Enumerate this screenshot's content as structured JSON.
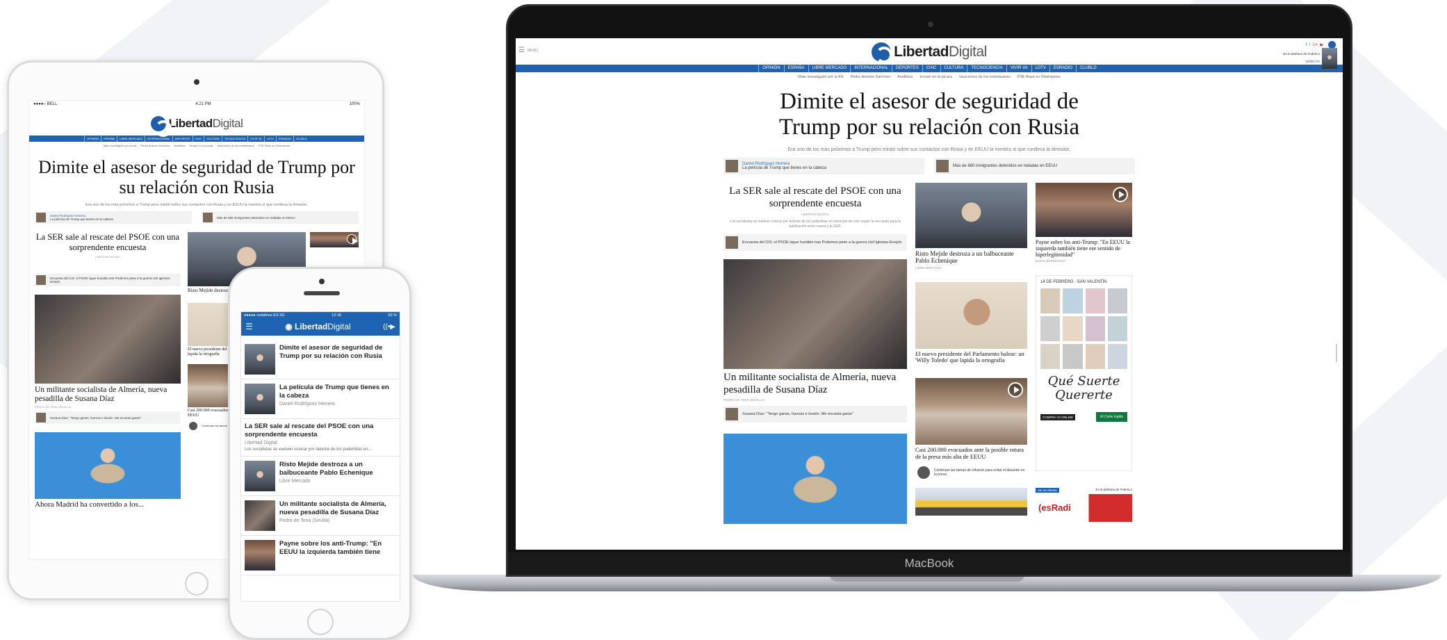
{
  "brand": {
    "name_a": "Libertad",
    "name_b": "Digital",
    "accent": "#1e63b1"
  },
  "macbook": {
    "label": "MacBook",
    "menu_label": "MENÚ",
    "live_label": "DIRECTO",
    "promo_text": "Es la Mañana de Federico",
    "nav": [
      "OPINIÓN",
      "ESPAÑA",
      "LIBRE MERCADO",
      "INTERNACIONAL",
      "DEPORTES",
      "CHIC",
      "CULTURA",
      "TECNOCIENCIA",
      "VIVIR VA",
      "LDTV",
      "ESRADIO",
      "CLUBLD"
    ],
    "subnav": [
      "Malo investigado por la AN",
      "Pedro Antonio Sánchez",
      "Anellidos",
      "Ermán en la pícara",
      "Vasiciones de los entrelauerra",
      "PSE Raxe es Ghampions"
    ],
    "headline": "Dimite el asesor de seguridad de Trump por su relación con Rusia",
    "dek": "Era uno de los más próximos a Trump pero mintió sobre sus contactos con Rusia y en EEUU la mentira sí que conlleva la dimisión.",
    "related": [
      {
        "author": "Daniel Rodríguez Herrera",
        "title": "La película de Trump que tienes en la cabeza"
      },
      {
        "author": "",
        "title": "Más de 680 inmigrantes detenidos en redadas en EEUU"
      }
    ],
    "col1": {
      "lead_title": "La SER sale al rescate del PSOE con una sorprendente encuesta",
      "lead_by": "LIBERTAD DIGITAL",
      "lead_dek": "Los socialistas se vuelven colocar por delante de los podemitas en intención de voto según la encuesta para la publicación entre marzo y la SER.",
      "lead_related": "Encuesta del CIS: el PSOE sigue hundido tras Podemos pese a la guerra civil Iglesias-Errejón",
      "photo_title": "Un militante socialista de Almería, nueva pesadilla de Susana Díaz",
      "photo_by": "PEDRO DE TENA (SEVILLA)",
      "photo_related": "Susana Díaz: \"Tengo ganas, fuerzas e ilusión. Me encanta ganar\""
    },
    "col2": [
      {
        "title": "Risto Mejide destroza a un balbuceante Pablo Echenique",
        "by": "LIBRE MERCADO"
      },
      {
        "title": "El nuevo presidente del Parlamento balear: un 'Willy Toledo' que lapida la ortografía",
        "by": ""
      },
      {
        "title": "Casi 200.000 evacuados ante la posible rotura de la presa más alta de EEUU",
        "by": "",
        "related": "Continúan las tareas de refuerzo para evitar el desastre en la presa"
      }
    ],
    "col3": {
      "story_title": "Payne sobre los anti-Trump: \"En EEUU la izquierda también tiene ese sentido de hiperlegitimidad\"",
      "story_by": "ELENA BERBERANA",
      "ad_date": "14 DE FEBRERO · SAN VALENTÍN",
      "ad_slogan": "Qué Suerte Quererte",
      "ad_cta": "COMPRA YA ONLINE",
      "ad_brand": "El Corte Inglés",
      "radio_tag": "Ver en directo",
      "radio_show": "Es la Mañana de Federico",
      "radio_logo": "(esRadi"
    }
  },
  "ipad": {
    "status_carrier": "●●●●○ BELL",
    "status_time": "4:21 PM",
    "status_battery": "100%",
    "nav": [
      "OPINIÓN",
      "ESPAÑA",
      "LIBRE MERCADO",
      "INTERNACIONAL",
      "DEPORTES",
      "CHIC",
      "CULTURA",
      "TECNOCIENCIA",
      "VIVIR VA",
      "LDTV",
      "ESRADIO",
      "CLUBLD"
    ],
    "subnav": [
      "Malo investigado por la AN",
      "Pedro Antonio Sánchez",
      "Anellidos",
      "Ermán en la pícara",
      "Vasiciones de los entrelauerra",
      "PSE Raxe es Ghampions"
    ],
    "headline": "Dimite el asesor de seguridad de Trump por su relación con Rusia",
    "dek": "Era uno de los más próximos a Trump pero mintió sobre sus contactos con Rusia y en EEUU la mentira sí que conlleva la dimisión.",
    "related": [
      {
        "author": "Daniel Rodríguez Herrera",
        "title": "La película de Trump que tienes en la cabeza"
      },
      {
        "author": "",
        "title": "Más de 680 inmigrantes detenidos en redadas en EEUU"
      }
    ],
    "lead_title": "La SER sale al rescate del PSOE con una sorprendente encuesta",
    "lead_by": "LIBERTAD DIGITAL",
    "lead_related": "Encuesta del CIS: el PSOE sigue hundido tras Podemos pese a la guerra civil Iglesias-Errejón",
    "side_title": "Risto Mejide destroza a un balbuceante Pablo Echenique",
    "side_title2": "El nuevo presidente del Parlamento balear: un 'Willy Toledo' que lapida la ortografía",
    "side_title3": "Casi 200.000 evacuados ante la posible rotura de la presa más alta de EEUU",
    "side_related": "Continúan las tareas de refuerzo para evitar el desastre en la presa",
    "photo_title": "Un militante socialista de Almería, nueva pesadilla de Susana Díaz",
    "photo_by": "PEDRO DE TENA (SEVILLA)",
    "photo_related": "Susana Díaz: \"Tengo ganas, fuerzas e ilusión. Me encanta ganar\"",
    "bottom_title": "Ahora Madrid ha convertido a los..."
  },
  "iphone": {
    "status_carrier": "●●●●● vodafone ES  3G",
    "status_time": "12:18",
    "status_battery": "63 %",
    "items": [
      {
        "title": "Dimite el asesor de seguridad de Trump por su relación con Rusia",
        "sub": ""
      },
      {
        "title": "La película de Trump que tienes en la cabeza",
        "sub": "Daniel Rodríguez Herrera"
      },
      {
        "title": "Risto Mejide destroza a un balbuceante Pablo Echenique",
        "sub": "Libre Mercado"
      },
      {
        "title": "Un militante socialista de Almería, nueva pesadilla de Susana Díaz",
        "sub": "Pedro de Tena (Sevilla)"
      },
      {
        "title": "Payne sobre los anti-Trump: \"En EEUU la izquierda también tiene",
        "sub": ""
      }
    ],
    "text_item": {
      "title": "La SER sale al rescate del PSOE con una sorprendente encuesta",
      "sub": "Libertad Digital",
      "dek": "Los socialistas se vuelven colocar por delante de los podemitas en..."
    }
  }
}
